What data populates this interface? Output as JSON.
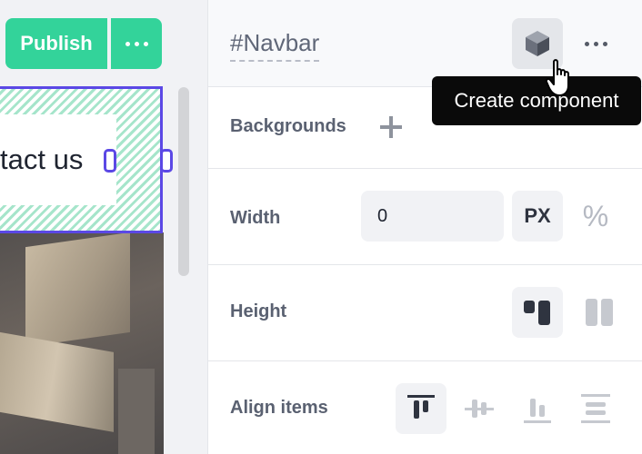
{
  "toolbar": {
    "publish_label": "Publish",
    "more_icon": "ellipsis-icon"
  },
  "canvas": {
    "nav_link_text": "tact us",
    "background_image": "brick-wall-photo"
  },
  "panel": {
    "element_name": "Navbar",
    "hash_symbol": "#",
    "component_icon": "cube-icon",
    "more_icon": "ellipsis-icon"
  },
  "tooltip": {
    "text": "Create component"
  },
  "sections": {
    "backgrounds": {
      "label": "Backgrounds",
      "icon": "plus-icon"
    },
    "width": {
      "label": "Width",
      "value": "0",
      "unit_px": "PX",
      "unit_percent": "%"
    },
    "height": {
      "label": "Height",
      "options": [
        "height-auto-icon",
        "height-stretch-icon"
      ],
      "selected": "height-auto-icon"
    },
    "align_items": {
      "label": "Align items",
      "options": [
        "align-start-icon",
        "align-center-icon",
        "align-end-icon",
        "align-stretch-icon"
      ],
      "selected": "align-start-icon"
    }
  },
  "colors": {
    "publish_green": "#33d39a",
    "selection_purple": "#5b48e5",
    "tooltip_bg": "#0a0a0a"
  }
}
